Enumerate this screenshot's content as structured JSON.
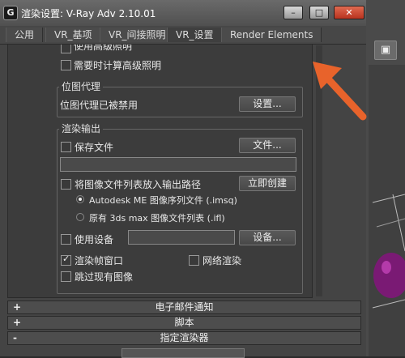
{
  "window": {
    "title": "渲染设置: V-Ray Adv 2.10.01",
    "app_icon_glyph": "G",
    "minimize_glyph": "–",
    "maximize_glyph": "□",
    "close_glyph": "✕"
  },
  "tabs": [
    "公用",
    "VR_基项",
    "VR_间接照明",
    "VR_设置",
    "Render Elements"
  ],
  "panel": {
    "partial_top_label": "使用高级照明",
    "compute_advanced_lighting_label": "需要时计算高级照明",
    "bitmap_proxy": {
      "title": "位图代理",
      "status": "位图代理已被禁用",
      "settings_button": "设置..."
    },
    "render_output": {
      "title": "渲染输出",
      "save_file_label": "保存文件",
      "file_button": "文件...",
      "file_path_value": "",
      "put_image_list_label": "将图像文件列表放入输出路径",
      "create_now_button": "立即创建",
      "radio_imsq_label": "Autodesk ME 图像序列文件 (.imsq)",
      "radio_ifl_label": "原有 3ds max 图像文件列表 (.ifl)",
      "use_device_label": "使用设备",
      "device_value": "",
      "device_button": "设备...",
      "rendered_frame_window_label": "渲染帧窗口",
      "net_render_label": "网络渲染",
      "skip_existing_label": "跳过现有图像"
    }
  },
  "rollouts": [
    {
      "sign": "+",
      "label": "电子邮件通知"
    },
    {
      "sign": "+",
      "label": "脚本"
    },
    {
      "sign": "-",
      "label": "指定渲染器"
    }
  ],
  "toolbar_icon_glyph": "▣",
  "accent_arrow_color": "#e8632b"
}
